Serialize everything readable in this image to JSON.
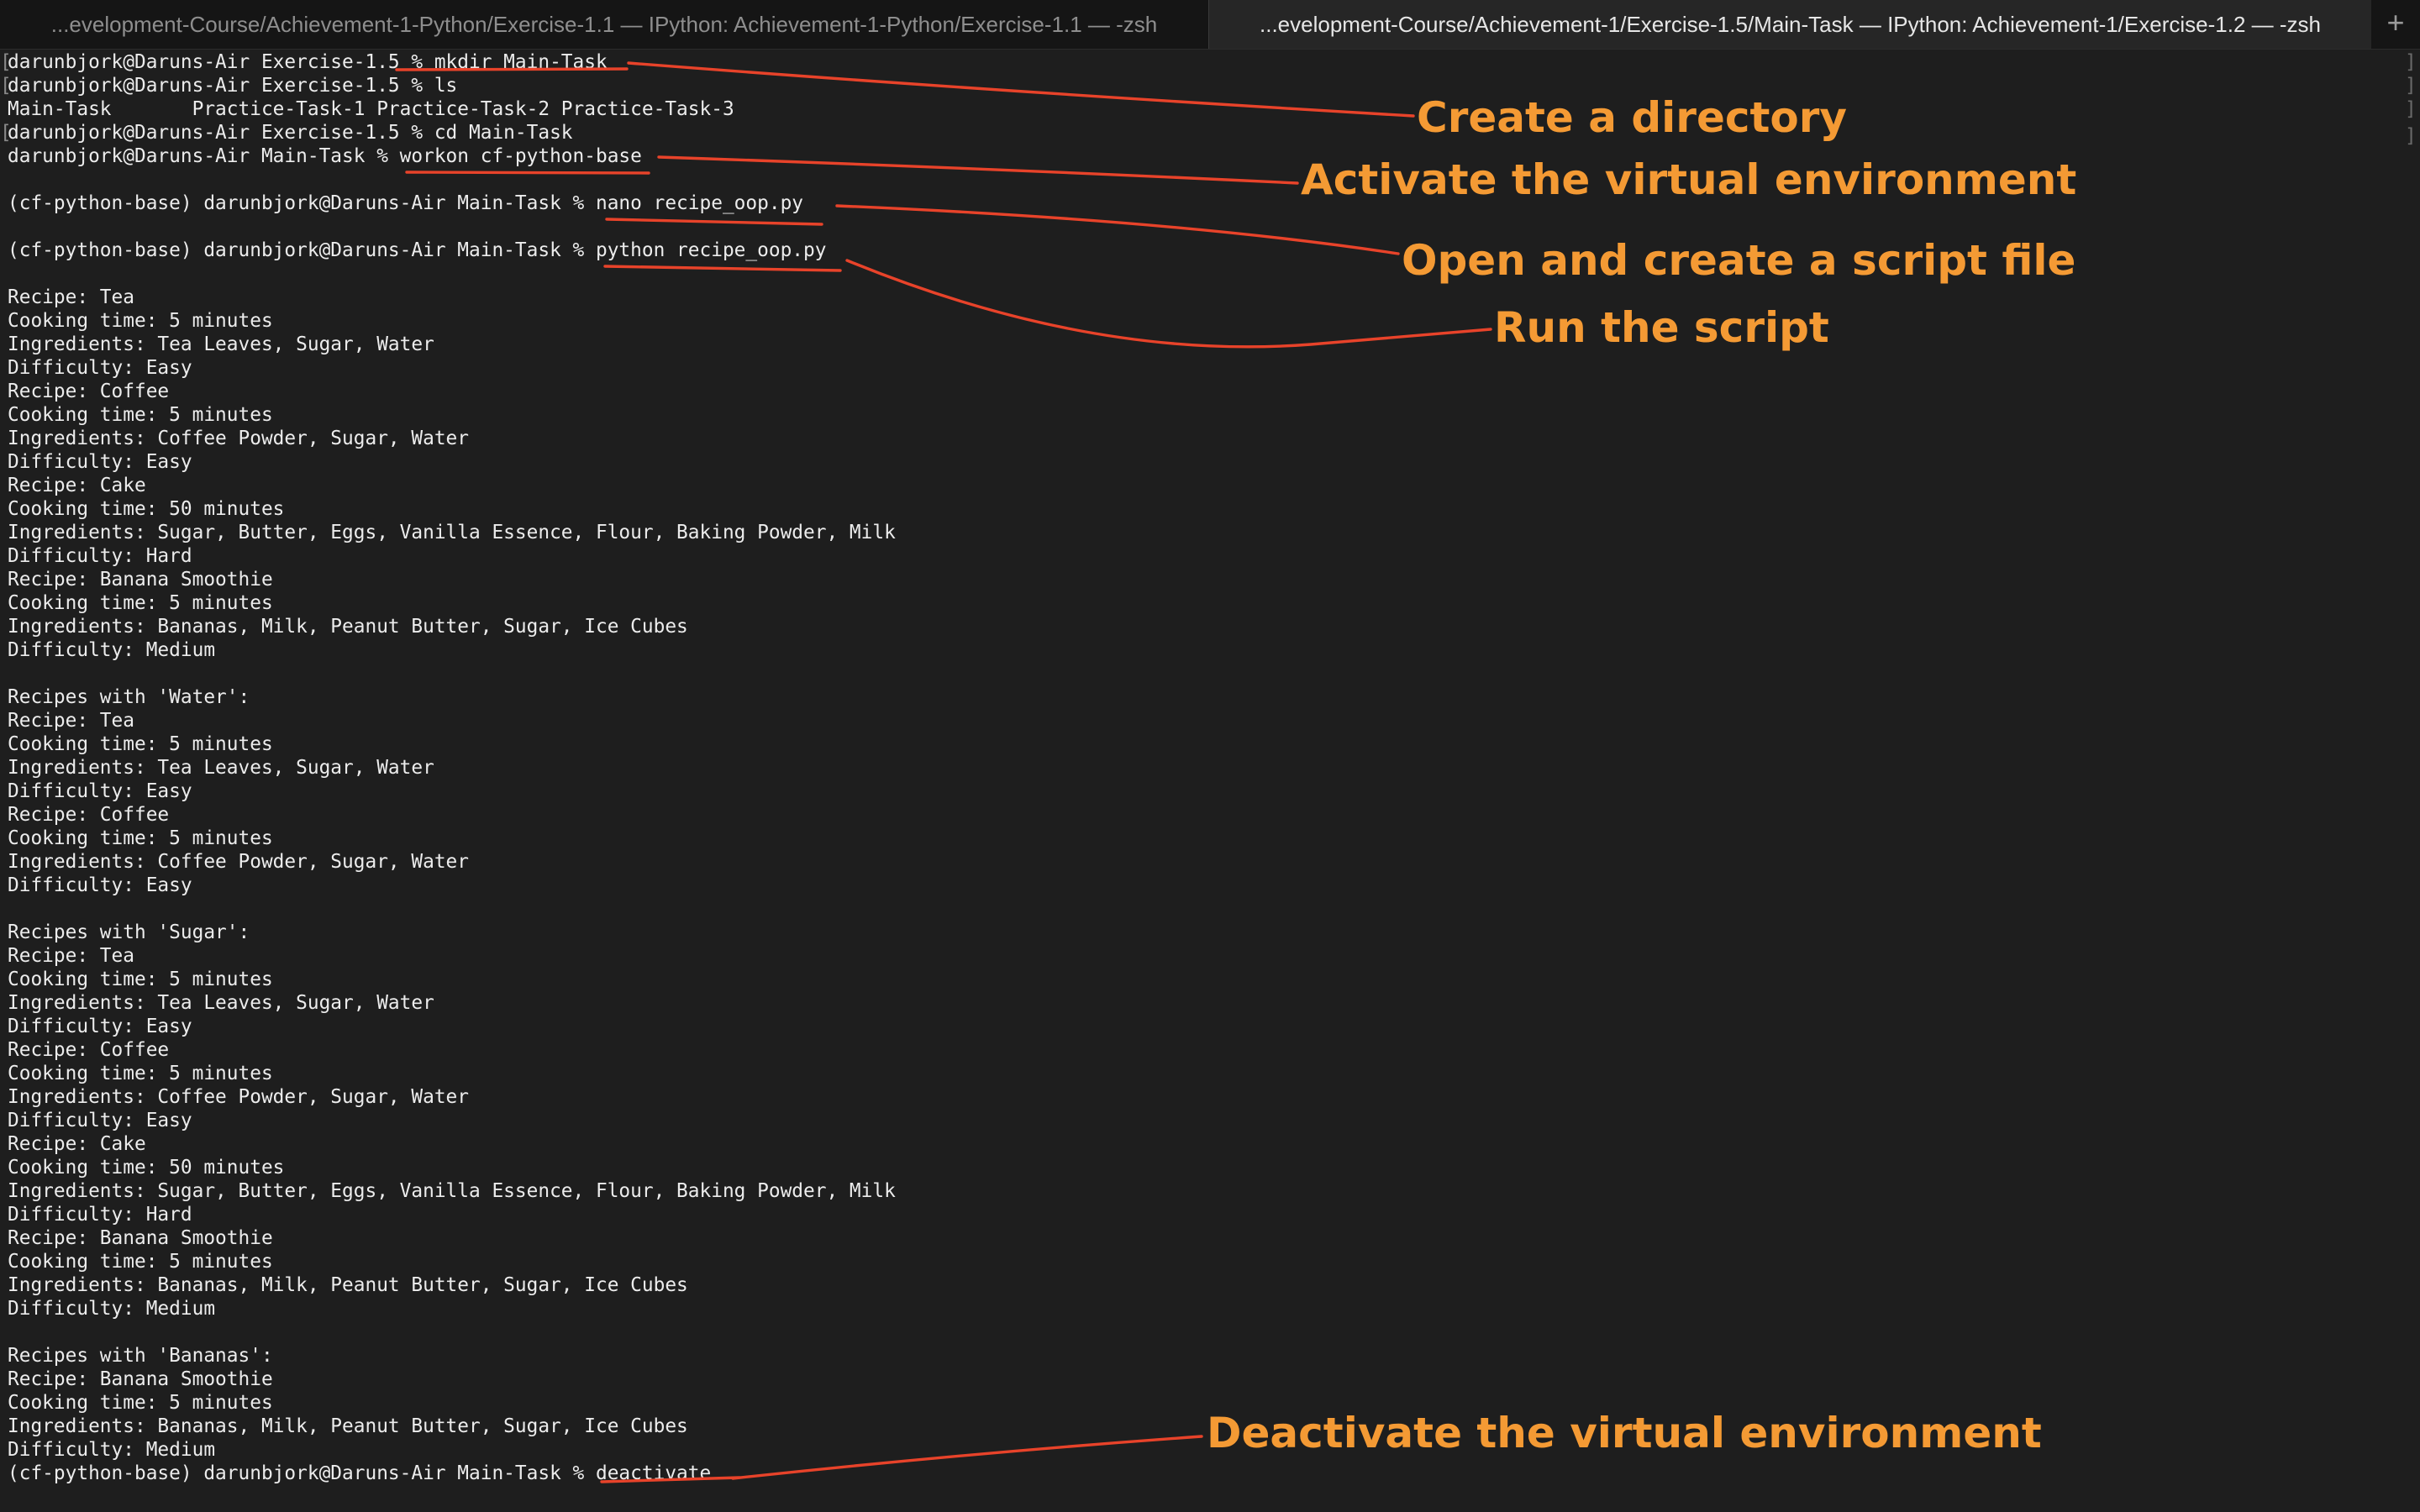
{
  "tabs": {
    "inactive_title": "...evelopment-Course/Achievement-1-Python/Exercise-1.1 — IPython: Achievement-1-Python/Exercise-1.1 — -zsh",
    "active_title": "...evelopment-Course/Achievement-1/Exercise-1.5/Main-Task — IPython: Achievement-1/Exercise-1.2 — -zsh",
    "new_tab_symbol": "+"
  },
  "terminal": {
    "lines": [
      "darunbjork@Daruns-Air Exercise-1.5 % mkdir Main-Task",
      "darunbjork@Daruns-Air Exercise-1.5 % ls",
      "Main-Task       Practice-Task-1 Practice-Task-2 Practice-Task-3",
      "darunbjork@Daruns-Air Exercise-1.5 % cd Main-Task",
      "darunbjork@Daruns-Air Main-Task % workon cf-python-base",
      "",
      "(cf-python-base) darunbjork@Daruns-Air Main-Task % nano recipe_oop.py",
      "",
      "(cf-python-base) darunbjork@Daruns-Air Main-Task % python recipe_oop.py",
      "",
      "Recipe: Tea",
      "Cooking time: 5 minutes",
      "Ingredients: Tea Leaves, Sugar, Water",
      "Difficulty: Easy",
      "Recipe: Coffee",
      "Cooking time: 5 minutes",
      "Ingredients: Coffee Powder, Sugar, Water",
      "Difficulty: Easy",
      "Recipe: Cake",
      "Cooking time: 50 minutes",
      "Ingredients: Sugar, Butter, Eggs, Vanilla Essence, Flour, Baking Powder, Milk",
      "Difficulty: Hard",
      "Recipe: Banana Smoothie",
      "Cooking time: 5 minutes",
      "Ingredients: Bananas, Milk, Peanut Butter, Sugar, Ice Cubes",
      "Difficulty: Medium",
      "",
      "Recipes with 'Water':",
      "Recipe: Tea",
      "Cooking time: 5 minutes",
      "Ingredients: Tea Leaves, Sugar, Water",
      "Difficulty: Easy",
      "Recipe: Coffee",
      "Cooking time: 5 minutes",
      "Ingredients: Coffee Powder, Sugar, Water",
      "Difficulty: Easy",
      "",
      "Recipes with 'Sugar':",
      "Recipe: Tea",
      "Cooking time: 5 minutes",
      "Ingredients: Tea Leaves, Sugar, Water",
      "Difficulty: Easy",
      "Recipe: Coffee",
      "Cooking time: 5 minutes",
      "Ingredients: Coffee Powder, Sugar, Water",
      "Difficulty: Easy",
      "Recipe: Cake",
      "Cooking time: 50 minutes",
      "Ingredients: Sugar, Butter, Eggs, Vanilla Essence, Flour, Baking Powder, Milk",
      "Difficulty: Hard",
      "Recipe: Banana Smoothie",
      "Cooking time: 5 minutes",
      "Ingredients: Bananas, Milk, Peanut Butter, Sugar, Ice Cubes",
      "Difficulty: Medium",
      "",
      "Recipes with 'Bananas':",
      "Recipe: Banana Smoothie",
      "Cooking time: 5 minutes",
      "Ingredients: Bananas, Milk, Peanut Butter, Sugar, Ice Cubes",
      "Difficulty: Medium",
      "(cf-python-base) darunbjork@Daruns-Air Main-Task % deactivate"
    ],
    "left_bracket": "[",
    "right_bracket": "]"
  },
  "annotations": {
    "create_directory": "Create a directory",
    "activate_env": "Activate the virtual environment",
    "open_script": "Open and create a script file",
    "run_script": "Run the script",
    "deactivate_env": "Deactivate the virtual environment"
  },
  "colors": {
    "annotation_text": "#f49a34",
    "annotation_line": "#e8432a",
    "terminal_bg": "#1e1e1e",
    "terminal_text": "#ececec"
  }
}
